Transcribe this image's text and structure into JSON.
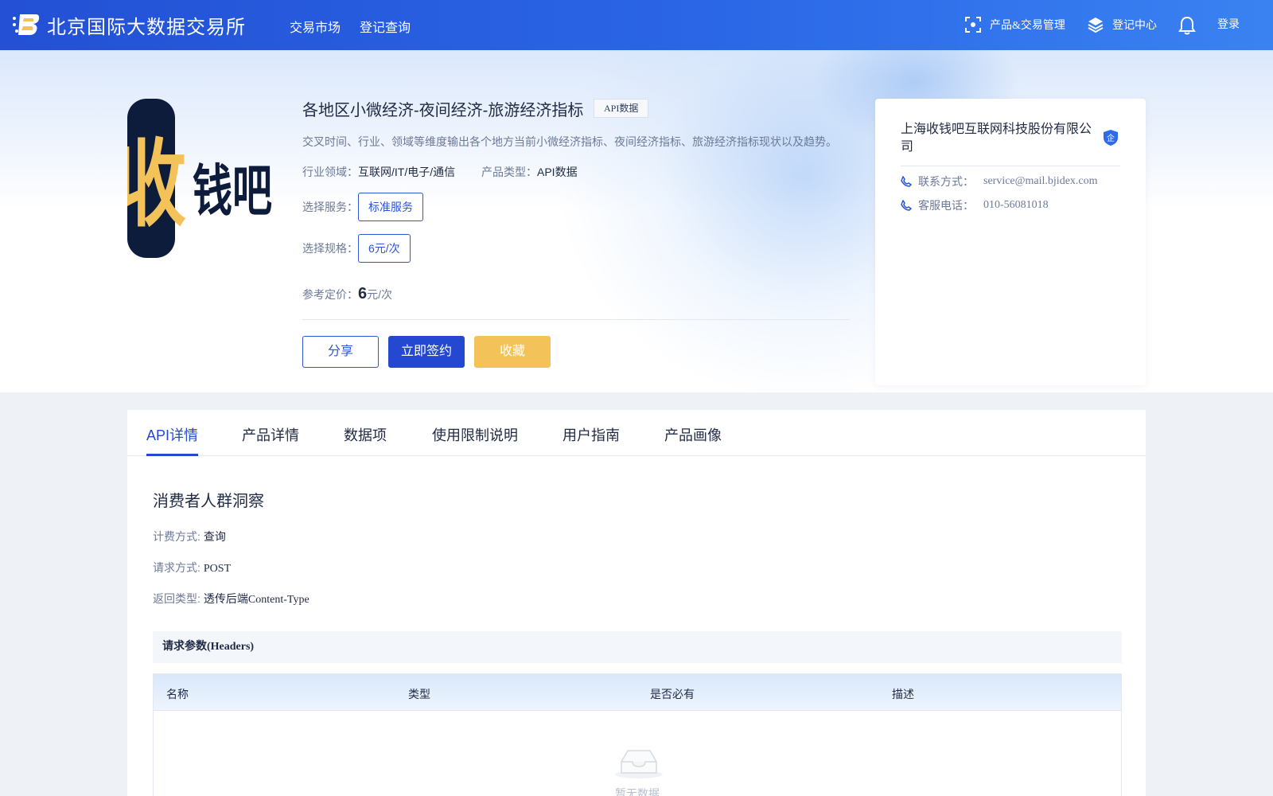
{
  "header": {
    "site_title": "北京国际大数据交易所",
    "nav": [
      "交易市场",
      "登记查询"
    ],
    "product_mgmt": "产品&交易管理",
    "register_center": "登记中心",
    "login": "登录",
    "colors": {
      "bar_start": "#2350d4",
      "bar_end": "#3a82f2",
      "logo_accent": "#f3c35a"
    }
  },
  "product": {
    "logo_text": "收钱吧",
    "title": "各地区小微经济-夜间经济-旅游经济指标",
    "tag": "API数据",
    "description": "交叉时间、行业、领域等维度输出各个地方当前小微经济指标、夜间经济指标、旅游经济指标现状以及趋势。",
    "industry_label": "行业领域：",
    "industry_value": "互联网/IT/电子/通信",
    "type_label": "产品类型：",
    "type_value": "API数据",
    "service_label": "选择服务：",
    "service_option": "标准服务",
    "spec_label": "选择规格：",
    "spec_option": "6元/次",
    "price_label": "参考定价：",
    "price_value": "6",
    "price_unit": "元/次",
    "buttons": {
      "share": "分享",
      "sign": "立即签约",
      "favorite": "收藏"
    }
  },
  "company": {
    "name": "上海收钱吧互联网科技股份有限公司",
    "badge": "企",
    "contact_label": "联系方式：",
    "contact_value": "service@mail.bjidex.com",
    "phone_label": "客服电话：",
    "phone_value": "010-56081018"
  },
  "tabs": [
    "API详情",
    "产品详情",
    "数据项",
    "使用限制说明",
    "用户指南",
    "产品画像"
  ],
  "api_detail": {
    "section_title": "消费者人群洞察",
    "billing_label": "计费方式:",
    "billing_value": "查询",
    "method_label": "请求方式:",
    "method_value": "POST",
    "return_label": "返回类型:",
    "return_value": "透传后端Content-Type",
    "headers_title": "请求参数(Headers)",
    "table_columns": [
      "名称",
      "类型",
      "是否必有",
      "描述"
    ],
    "empty_text": "暂无数据"
  }
}
